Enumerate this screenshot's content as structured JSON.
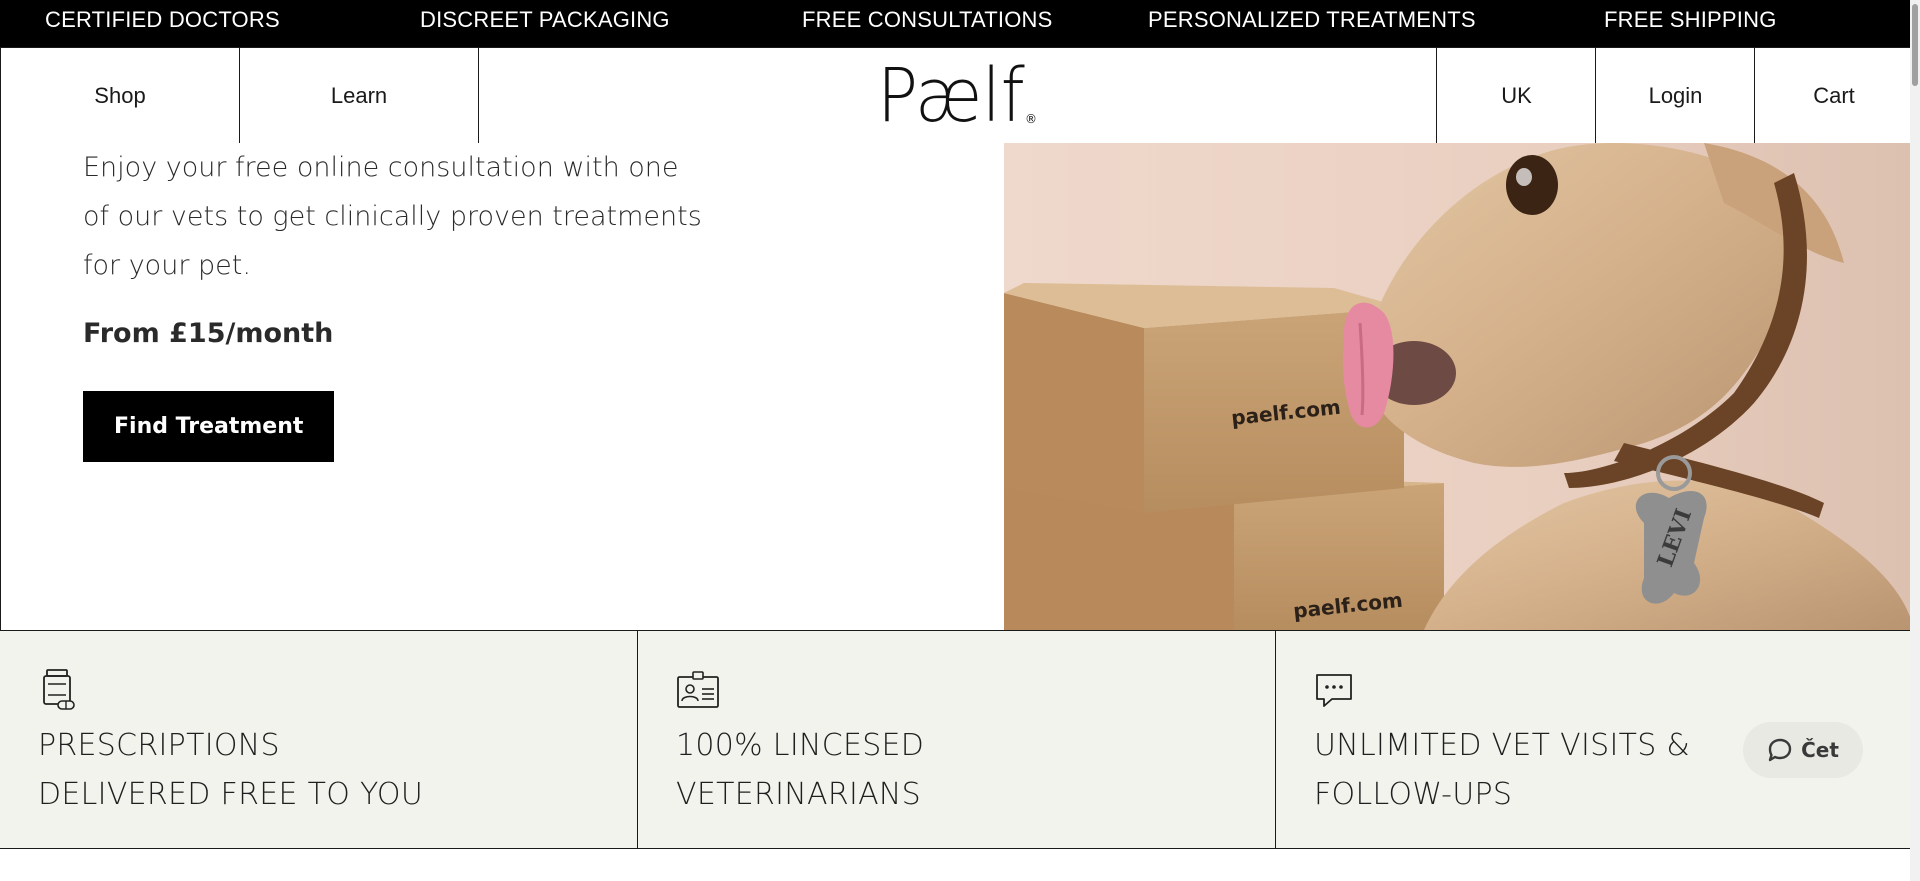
{
  "announcement": {
    "items": [
      "CERTIFIED DOCTORS",
      "DISCREET PACKAGING",
      "FREE CONSULTATIONS",
      "PERSONALIZED TREATMENTS",
      "FREE SHIPPING"
    ]
  },
  "header": {
    "nav_left": [
      "Shop",
      "Learn"
    ],
    "logo": "Pælf",
    "logo_mark": "®",
    "nav_right": [
      "UK",
      "Login",
      "Cart"
    ]
  },
  "hero": {
    "description": "Enjoy your free online consultation with one of our vets to get clinically proven treatments for your pet.",
    "price": "From £15/month",
    "cta": "Find Treatment",
    "image": {
      "box_text": "paelf.com",
      "tag_text": "LEVI"
    }
  },
  "features": [
    {
      "icon": "pill-bottle-icon",
      "line1": "PRESCRIPTIONS",
      "line2": "DELIVERED FREE TO YOU"
    },
    {
      "icon": "id-card-icon",
      "line1": "100% LINCESED",
      "line2": "VETERINARIANS"
    },
    {
      "icon": "chat-bubble-icon",
      "line1": "UNLIMITED VET VISITS &",
      "line2": "FOLLOW-UPS"
    }
  ],
  "chat": {
    "label": "Čet",
    "icon": "speech-bubble-icon"
  },
  "colors": {
    "bar": "#000000",
    "features_bg": "#f3f3ee",
    "cta_bg": "#000000"
  }
}
